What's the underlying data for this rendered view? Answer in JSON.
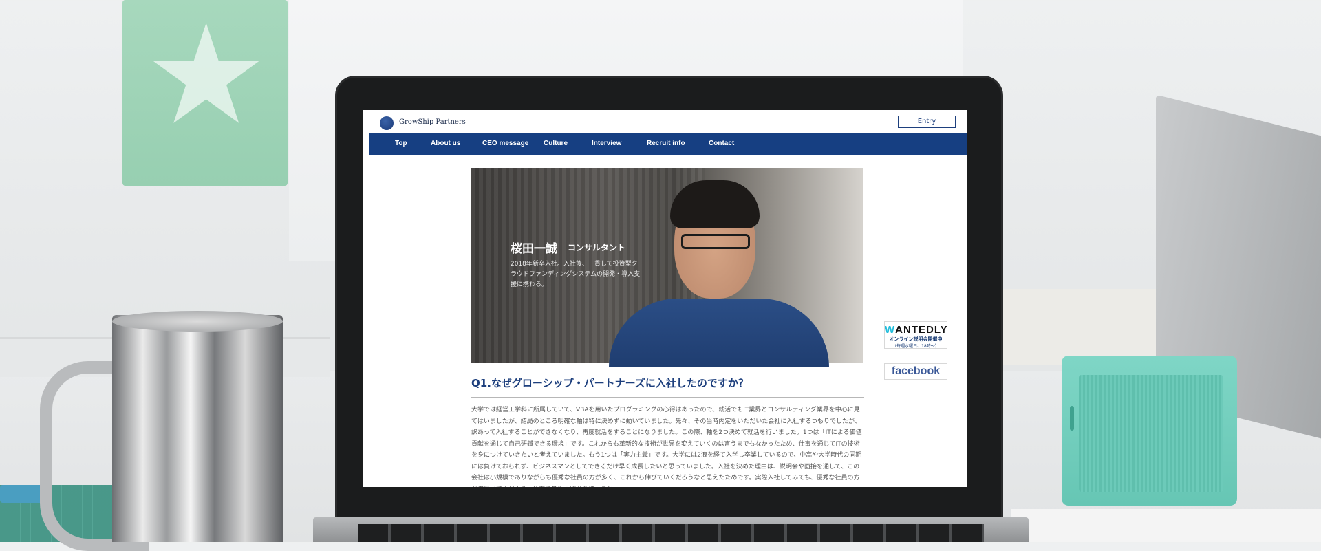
{
  "site": {
    "brand": "GrowShip Partners",
    "entry_label": "Entry"
  },
  "nav": {
    "items": [
      "Top",
      "About us",
      "CEO message",
      "Culture",
      "Interview",
      "Recruit info",
      "Contact"
    ]
  },
  "hero": {
    "name": "桜田一誠",
    "role": "コンサルタント",
    "description": "2018年新卒入社。入社後、一貫して投資型クラウドファンディングシステムの開発・導入支援に携わる。"
  },
  "question": {
    "title": "Q1.なぜグローシップ・パートナーズに入社したのですか？",
    "body": "大学では経営工学科に所属していて、VBAを用いたプログラミングの心得はあったので、就活でもIT業界とコンサルティング業界を中心に見てはいましたが、結局のところ明確な軸は特に決めずに動いていました。先々、その当時内定をいただいた会社に入社するつもりでしたが、訳あって入社することができなくなり、再度就活をすることになりました。この際、軸を2つ決めて就活を行いました。1つは「ITによる価値貢献を通じて自己研鑽できる環境」です。これからも革新的な技術が世界を変えていくのは言うまでもなかったため、仕事を通じてITの技術を身につけていきたいと考えていました。もう1つは「実力主義」です。大学には2浪を経て入学し卒業しているので、中高や大学時代の同期には負けておられず、ビジネスマンとしてできるだけ早く成長したいと思っていました。入社を決めた理由は、説明会や面接を通して、この会社は小規模でありながらも優秀な社員の方が多く、これから伸びていくだろうなと思えたためです。実際入社してみても、優秀な社員の方が傍にいてくださり、仕事で身近な問題を持つこと"
  },
  "sidebar": {
    "wantedly_logo_w": "W",
    "wantedly_logo_rest": "ANTEDLY",
    "wantedly_event": "オンライン説明会開催中",
    "wantedly_schedule": "（毎週水曜日、18時〜）",
    "facebook": "facebook"
  }
}
